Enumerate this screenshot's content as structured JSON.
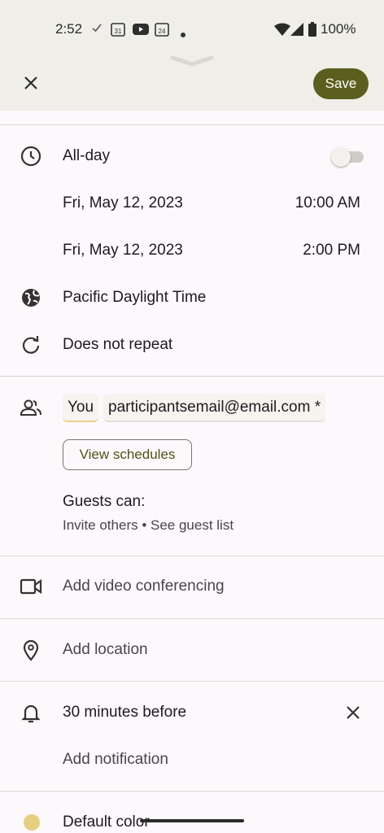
{
  "status_bar": {
    "time": "2:52",
    "battery": "100%",
    "icons": [
      "check-icon",
      "calendar-31-icon",
      "youtube-icon",
      "calendar-24-icon",
      "dot-icon",
      "wifi-icon",
      "signal-icon",
      "battery-icon"
    ],
    "cal_a": "31",
    "cal_b": "24"
  },
  "header": {
    "save_label": "Save",
    "accent_color": "#5b5f1e"
  },
  "event": {
    "all_day_label": "All-day",
    "all_day_on": false,
    "start_date": "Fri, May 12, 2023",
    "start_time": "10:00 AM",
    "end_date": "Fri, May 12, 2023",
    "end_time": "2:00 PM",
    "timezone": "Pacific Daylight Time",
    "repeat": "Does not repeat"
  },
  "guests": {
    "chips": [
      "You",
      "participantsemail@email.com *"
    ],
    "view_schedules_label": "View schedules",
    "guests_can_label": "Guests can:",
    "permissions": "Invite others • See guest list"
  },
  "conferencing": {
    "label": "Add video conferencing"
  },
  "location": {
    "label": "Add location"
  },
  "notification": {
    "value": "30 minutes before",
    "add_label": "Add notification"
  },
  "color": {
    "label": "Default color",
    "swatch": "#e6cf7e"
  }
}
